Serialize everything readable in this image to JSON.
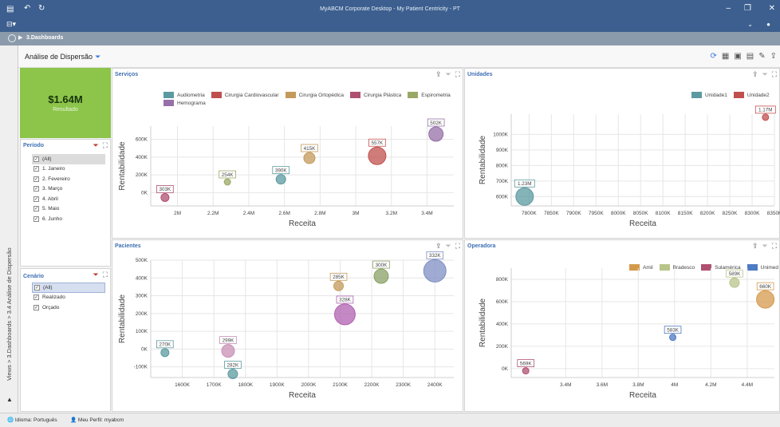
{
  "window": {
    "title": "MyABCM Corporate Desktop - My Patient Centricity - PT",
    "undo_icon": "undo-icon",
    "redo_icon": "redo-icon"
  },
  "nav": {
    "breadcrumb": "3.Dashboards"
  },
  "side_tab": {
    "text": "Views > 3.Dashboards > 3.4 Análise de Dispersão"
  },
  "page": {
    "title": "Análise de Dispersão"
  },
  "kpi": {
    "value": "$1.64M",
    "label": "Resultado"
  },
  "periodo": {
    "title": "Período",
    "items": [
      "(All)",
      "1. Janeiro",
      "2. Fevereiro",
      "3. Março",
      "4. Abril",
      "5. Maio",
      "6. Junho"
    ]
  },
  "cenario": {
    "title": "Cenário",
    "items": [
      "(All)",
      "Realizado",
      "Orçado"
    ]
  },
  "status": {
    "idioma": "Idioma: Português",
    "perfil": "Meu Perfil: myabcm"
  },
  "chart_data": [
    {
      "id": "servicos",
      "title": "Serviços",
      "type": "scatter",
      "xlabel": "Receita",
      "ylabel": "Rentabilidade",
      "xlim": [
        1.85,
        3.55
      ],
      "ylim": [
        -150,
        750
      ],
      "xticks": [
        2,
        2.2,
        2.4,
        2.6,
        2.8,
        3,
        3.2,
        3.4
      ],
      "xtick_labels": [
        "2M",
        "2.2M",
        "2.4M",
        "2.6M",
        "2.8M",
        "3M",
        "3.2M",
        "3.4M"
      ],
      "yticks": [
        0,
        200,
        400,
        600
      ],
      "ytick_labels": [
        "0K",
        "200K",
        "400K",
        "600K"
      ],
      "legend": [
        "Audiometria",
        "Cirurgia Cardiovascular",
        "Cirurgia Ortopédica",
        "Cirurgia Plástica",
        "Espirometria",
        "Hemograma"
      ],
      "points": [
        {
          "name": "Audiometria",
          "x": 2.58,
          "y": 150,
          "label": "390K",
          "size": 6,
          "color": "#5b9aa0"
        },
        {
          "name": "Cirurgia Cardiovascular",
          "x": 3.12,
          "y": 415,
          "label": "557K",
          "size": 11,
          "color": "#c0504d"
        },
        {
          "name": "Cirurgia Ortopédica",
          "x": 2.74,
          "y": 390,
          "label": "415K",
          "size": 7,
          "color": "#c49a5a"
        },
        {
          "name": "Cirurgia Plástica",
          "x": 1.93,
          "y": -55,
          "label": "303K",
          "size": 5,
          "color": "#b05070"
        },
        {
          "name": "Espirometria",
          "x": 2.28,
          "y": 120,
          "label": "254K",
          "size": 4,
          "color": "#9aa865"
        },
        {
          "name": "Hemograma",
          "x": 3.45,
          "y": 660,
          "label": "502K",
          "size": 9,
          "color": "#9670a8"
        }
      ]
    },
    {
      "id": "unidades",
      "title": "Unidades",
      "type": "scatter",
      "xlabel": "Receita",
      "ylabel": "Rentabilidade",
      "xlim": [
        7760,
        8350
      ],
      "ylim": [
        540,
        1130
      ],
      "xticks": [
        7800,
        7850,
        7900,
        7950,
        8000,
        8050,
        8100,
        8150,
        8200,
        8250,
        8300,
        8350
      ],
      "xtick_labels": [
        "7800K",
        "7850K",
        "7900K",
        "7950K",
        "8000K",
        "8050K",
        "8100K",
        "8150K",
        "8200K",
        "8250K",
        "8300K",
        "8350K"
      ],
      "yticks": [
        600,
        700,
        800,
        900,
        1000
      ],
      "ytick_labels": [
        "600K",
        "700K",
        "800K",
        "900K",
        "1000K"
      ],
      "legend": [
        "Unidade1",
        "Unidade2"
      ],
      "points": [
        {
          "name": "Unidade1",
          "x": 7790,
          "y": 600,
          "label": "1.23M",
          "size": 11,
          "color": "#5b9aa0"
        },
        {
          "name": "Unidade2",
          "x": 8330,
          "y": 1110,
          "label": "1.17M",
          "size": 4,
          "color": "#c0504d"
        }
      ]
    },
    {
      "id": "pacientes",
      "title": "Pacientes",
      "type": "scatter",
      "xlabel": "Receita",
      "ylabel": "Rentabilidade",
      "xlim": [
        1500,
        2460
      ],
      "ylim": [
        -160,
        500
      ],
      "xticks": [
        1600,
        1700,
        1800,
        1900,
        2000,
        2100,
        2200,
        2300,
        2400
      ],
      "xtick_labels": [
        "1600K",
        "1700K",
        "1800K",
        "1900K",
        "2000K",
        "2100K",
        "2200K",
        "2300K",
        "2400K"
      ],
      "yticks": [
        -100,
        0,
        100,
        200,
        300,
        400,
        500
      ],
      "ytick_labels": [
        "-100K",
        "0K",
        "100K",
        "200K",
        "300K",
        "400K",
        "500K"
      ],
      "points": [
        {
          "name": "",
          "x": 1545,
          "y": -20,
          "label": "270K",
          "size": 5,
          "color": "#5b9aa0"
        },
        {
          "name": "",
          "x": 1745,
          "y": -10,
          "label": "299K",
          "size": 8,
          "color": "#c78fb6"
        },
        {
          "name": "",
          "x": 1760,
          "y": -140,
          "label": "282K",
          "size": 6,
          "color": "#5b9aa0"
        },
        {
          "name": "",
          "x": 2095,
          "y": 355,
          "label": "285K",
          "size": 6,
          "color": "#c49a5a"
        },
        {
          "name": "",
          "x": 2115,
          "y": 195,
          "label": "328K",
          "size": 13,
          "color": "#b062b0"
        },
        {
          "name": "",
          "x": 2230,
          "y": 410,
          "label": "300K",
          "size": 9,
          "color": "#8aa066"
        },
        {
          "name": "",
          "x": 2400,
          "y": 440,
          "label": "332K",
          "size": 14,
          "color": "#7f8fc4"
        }
      ]
    },
    {
      "id": "operadora",
      "title": "Operadora",
      "type": "scatter",
      "xlabel": "Receita",
      "ylabel": "Rentabilidade",
      "xlim": [
        3.1,
        4.55
      ],
      "ylim": [
        -80,
        900
      ],
      "xticks": [
        3.4,
        3.6,
        3.8,
        4,
        4.2,
        4.4
      ],
      "xtick_labels": [
        "3.4M",
        "3.6M",
        "3.8M",
        "4M",
        "4.2M",
        "4.4M"
      ],
      "yticks": [
        0,
        200,
        400,
        600,
        800
      ],
      "ytick_labels": [
        "0K",
        "200K",
        "400K",
        "600K",
        "800K"
      ],
      "legend": [
        "Amil",
        "Bradesco",
        "Sulamérica",
        "Unimed"
      ],
      "points": [
        {
          "name": "Amil",
          "x": 4.5,
          "y": 620,
          "label": "660K",
          "size": 11,
          "color": "#d49a4c"
        },
        {
          "name": "Bradesco",
          "x": 4.33,
          "y": 770,
          "label": "589K",
          "size": 6,
          "color": "#b8c48a"
        },
        {
          "name": "Sulamérica",
          "x": 3.18,
          "y": -20,
          "label": "569K",
          "size": 4,
          "color": "#b05070"
        },
        {
          "name": "Unimed",
          "x": 3.99,
          "y": 280,
          "label": "583K",
          "size": 4,
          "color": "#4f7ac4"
        }
      ]
    }
  ],
  "legend_colors": {
    "Audiometria": "#5b9aa0",
    "Cirurgia Cardiovascular": "#c0504d",
    "Cirurgia Ortopédica": "#c49a5a",
    "Cirurgia Plástica": "#b05070",
    "Espirometria": "#9aa865",
    "Hemograma": "#9670a8",
    "Unidade1": "#5b9aa0",
    "Unidade2": "#c0504d",
    "Amil": "#d49a4c",
    "Bradesco": "#b8c48a",
    "Sulamérica": "#b05070",
    "Unimed": "#4f7ac4"
  },
  "colors": {
    "titlebar": "#3c5f8f",
    "kpi": "#8cc54a",
    "panel_title": "#3d6fb2"
  }
}
